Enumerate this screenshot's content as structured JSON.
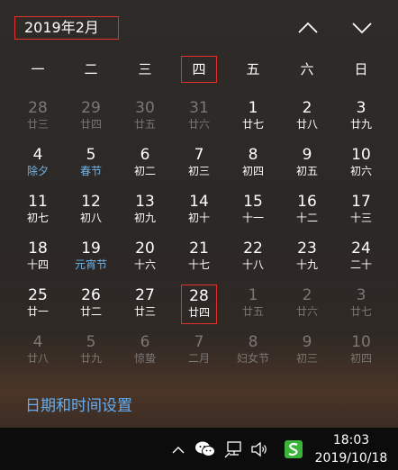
{
  "header": {
    "month_title": "2019年2月"
  },
  "weekdays": [
    "一",
    "二",
    "三",
    "四",
    "五",
    "六",
    "日"
  ],
  "weeks": [
    [
      {
        "day": "28",
        "lunar": "廿三",
        "in_month": false
      },
      {
        "day": "29",
        "lunar": "廿四",
        "in_month": false
      },
      {
        "day": "30",
        "lunar": "廿五",
        "in_month": false
      },
      {
        "day": "31",
        "lunar": "廿六",
        "in_month": false
      },
      {
        "day": "1",
        "lunar": "廿七",
        "in_month": true
      },
      {
        "day": "2",
        "lunar": "廿八",
        "in_month": true
      },
      {
        "day": "3",
        "lunar": "廿九",
        "in_month": true
      }
    ],
    [
      {
        "day": "4",
        "lunar": "除夕",
        "in_month": true,
        "festival": true
      },
      {
        "day": "5",
        "lunar": "春节",
        "in_month": true,
        "festival": true
      },
      {
        "day": "6",
        "lunar": "初二",
        "in_month": true
      },
      {
        "day": "7",
        "lunar": "初三",
        "in_month": true
      },
      {
        "day": "8",
        "lunar": "初四",
        "in_month": true
      },
      {
        "day": "9",
        "lunar": "初五",
        "in_month": true
      },
      {
        "day": "10",
        "lunar": "初六",
        "in_month": true
      }
    ],
    [
      {
        "day": "11",
        "lunar": "初七",
        "in_month": true
      },
      {
        "day": "12",
        "lunar": "初八",
        "in_month": true
      },
      {
        "day": "13",
        "lunar": "初九",
        "in_month": true
      },
      {
        "day": "14",
        "lunar": "初十",
        "in_month": true
      },
      {
        "day": "15",
        "lunar": "十一",
        "in_month": true
      },
      {
        "day": "16",
        "lunar": "十二",
        "in_month": true
      },
      {
        "day": "17",
        "lunar": "十三",
        "in_month": true
      }
    ],
    [
      {
        "day": "18",
        "lunar": "十四",
        "in_month": true
      },
      {
        "day": "19",
        "lunar": "元宵节",
        "in_month": true,
        "festival": true
      },
      {
        "day": "20",
        "lunar": "十六",
        "in_month": true
      },
      {
        "day": "21",
        "lunar": "十七",
        "in_month": true
      },
      {
        "day": "22",
        "lunar": "十八",
        "in_month": true
      },
      {
        "day": "23",
        "lunar": "十九",
        "in_month": true
      },
      {
        "day": "24",
        "lunar": "二十",
        "in_month": true
      }
    ],
    [
      {
        "day": "25",
        "lunar": "廿一",
        "in_month": true
      },
      {
        "day": "26",
        "lunar": "廿二",
        "in_month": true
      },
      {
        "day": "27",
        "lunar": "廿三",
        "in_month": true
      },
      {
        "day": "28",
        "lunar": "廿四",
        "in_month": true,
        "today": true
      },
      {
        "day": "1",
        "lunar": "廿五",
        "in_month": false
      },
      {
        "day": "2",
        "lunar": "廿六",
        "in_month": false
      },
      {
        "day": "3",
        "lunar": "廿七",
        "in_month": false
      }
    ],
    [
      {
        "day": "4",
        "lunar": "廿八",
        "in_month": false
      },
      {
        "day": "5",
        "lunar": "廿九",
        "in_month": false
      },
      {
        "day": "6",
        "lunar": "惊蛰",
        "in_month": false
      },
      {
        "day": "7",
        "lunar": "二月",
        "in_month": false
      },
      {
        "day": "8",
        "lunar": "妇女节",
        "in_month": false
      },
      {
        "day": "9",
        "lunar": "初三",
        "in_month": false
      },
      {
        "day": "10",
        "lunar": "初四",
        "in_month": false
      }
    ]
  ],
  "footer": {
    "settings_link": "日期和时间设置"
  },
  "taskbar": {
    "time": "18:03",
    "date": "2019/10/18",
    "icons": [
      "chevron-up-icon",
      "wechat-icon",
      "network-icon",
      "volume-icon",
      "sogou-ime-icon"
    ]
  },
  "colors": {
    "accent_border": "#e0322a",
    "festival_text": "#6fb4ea",
    "link": "#66aef0",
    "muted_text": "#7b7775"
  }
}
